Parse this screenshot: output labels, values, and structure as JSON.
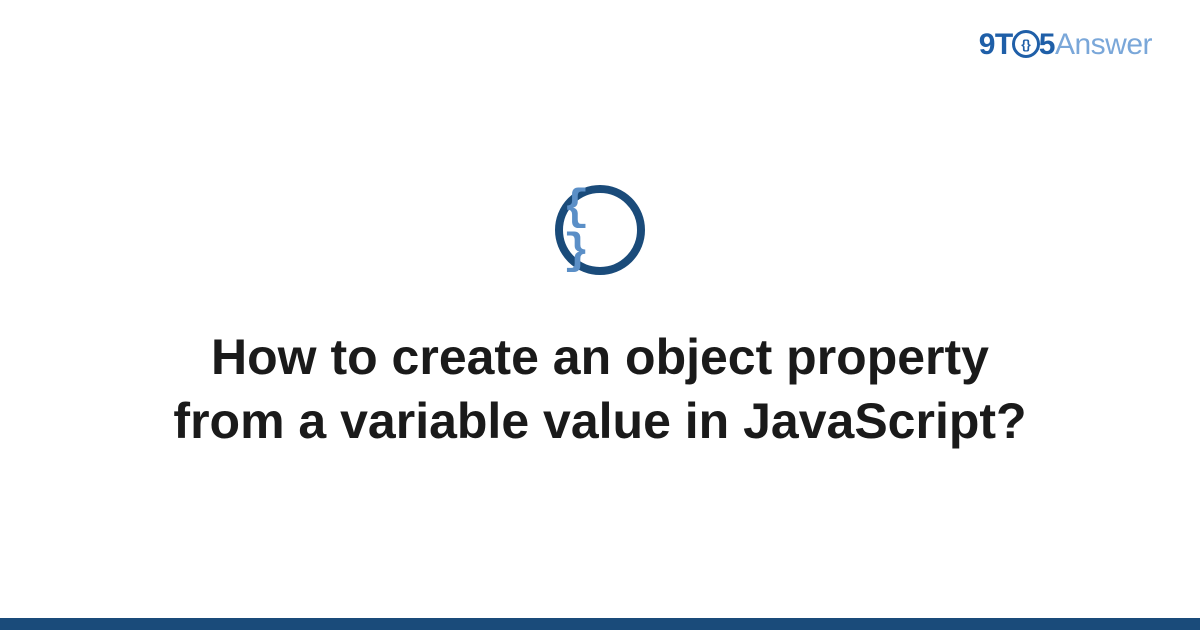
{
  "logo": {
    "part1": "9T",
    "circle_inner": "{}",
    "part2": "5",
    "part3": "Answer"
  },
  "icon": {
    "name": "braces-icon",
    "glyph": "{ }"
  },
  "title": "How to create an object property from a variable value in JavaScript?",
  "colors": {
    "brand_dark": "#1a4b7a",
    "brand_blue": "#1f5fa8",
    "brand_light": "#7aa7d9",
    "icon_fill": "#5b8fc7"
  }
}
